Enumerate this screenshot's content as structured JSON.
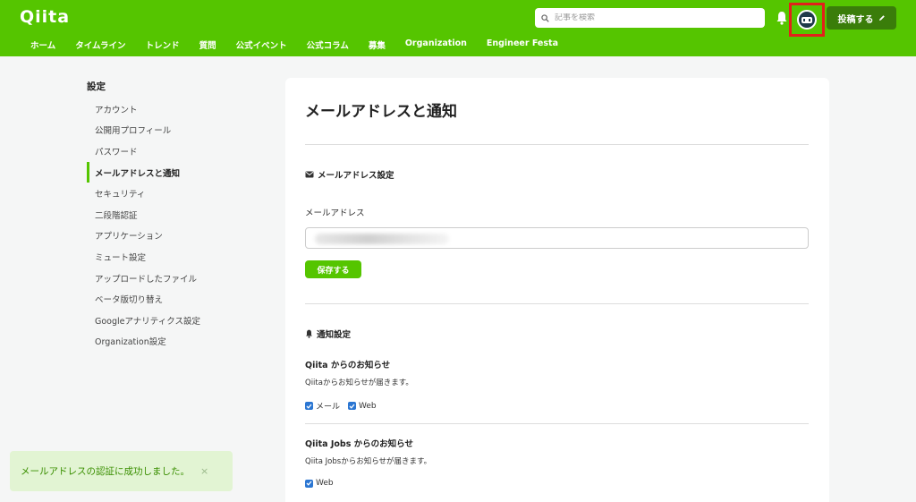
{
  "header": {
    "logo": "Qiita",
    "search_placeholder": "記事を検索",
    "post_button": "投稿する",
    "nav": [
      "ホーム",
      "タイムライン",
      "トレンド",
      "質問",
      "公式イベント",
      "公式コラム",
      "募集",
      "Organization",
      "Engineer Festa"
    ]
  },
  "sidebar": {
    "title": "設定",
    "items": [
      {
        "label": "アカウント",
        "active": false
      },
      {
        "label": "公開用プロフィール",
        "active": false
      },
      {
        "label": "パスワード",
        "active": false
      },
      {
        "label": "メールアドレスと通知",
        "active": true
      },
      {
        "label": "セキュリティ",
        "active": false
      },
      {
        "label": "二段階認証",
        "active": false
      },
      {
        "label": "アプリケーション",
        "active": false
      },
      {
        "label": "ミュート設定",
        "active": false
      },
      {
        "label": "アップロードしたファイル",
        "active": false
      },
      {
        "label": "ベータ版切り替え",
        "active": false
      },
      {
        "label": "Googleアナリティクス設定",
        "active": false
      },
      {
        "label": "Organization設定",
        "active": false
      }
    ]
  },
  "main": {
    "title": "メールアドレスと通知",
    "email_section": {
      "title": "メールアドレス設定",
      "field_label": "メールアドレス",
      "save_button": "保存する"
    },
    "notify_section": {
      "title": "通知設定",
      "groups": [
        {
          "title": "Qiita からのお知らせ",
          "desc": "Qiitaからお知らせが届きます。",
          "mail_label": "メール",
          "web_label": "Web"
        },
        {
          "title": "Qiita Jobs からのお知らせ",
          "desc": "Qiita Jobsからお知らせが届きます。",
          "web_label": "Web"
        }
      ]
    }
  },
  "toast": {
    "message": "メールアドレスの認証に成功しました。",
    "close": "×"
  },
  "colors": {
    "brand": "#55c500",
    "post_button": "#3a7d0a",
    "checkbox": "#2b76d2",
    "highlight": "#e3201b"
  }
}
